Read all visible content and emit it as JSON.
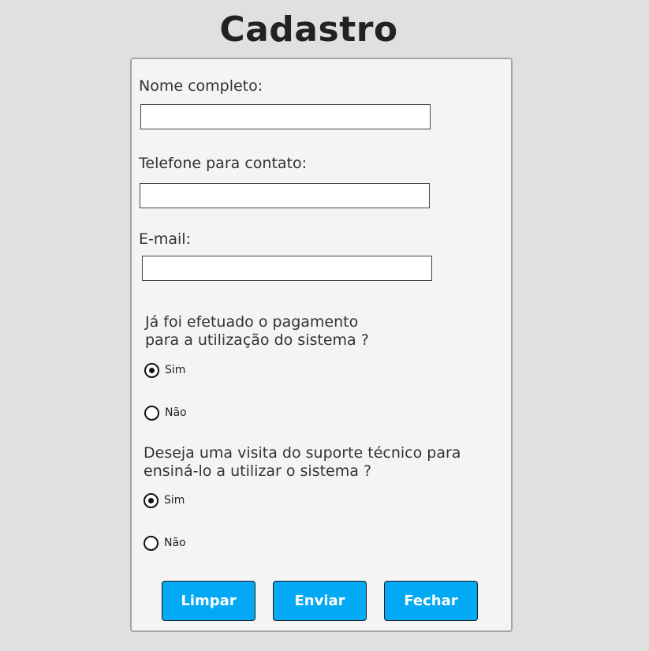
{
  "page": {
    "title": "Cadastro"
  },
  "form": {
    "fields": [
      {
        "label": "Nome completo:",
        "value": "",
        "placeholder": ""
      },
      {
        "label": "Telefone para contato:",
        "value": "",
        "placeholder": ""
      },
      {
        "label": "E-mail:",
        "value": "",
        "placeholder": ""
      }
    ],
    "questions": [
      {
        "lines": [
          "Já foi efetuado o pagamento",
          "para a utilização do sistema ?"
        ],
        "options": [
          {
            "label": "Sim",
            "checked": true
          },
          {
            "label": "Não",
            "checked": false
          }
        ]
      },
      {
        "lines": [
          "Deseja uma visita do suporte técnico para",
          "ensiná-lo a utilizar o sistema ?"
        ],
        "options": [
          {
            "label": "Sim",
            "checked": true
          },
          {
            "label": "Não",
            "checked": false
          }
        ]
      }
    ],
    "buttons": {
      "clear": "Limpar",
      "submit": "Enviar",
      "close": "Fechar"
    }
  },
  "colors": {
    "background": "#e0e0e0",
    "card": "#f4f4f4",
    "card_border": "#a4a4a4",
    "button": "#03a9f4",
    "button_text": "#ffffff"
  }
}
